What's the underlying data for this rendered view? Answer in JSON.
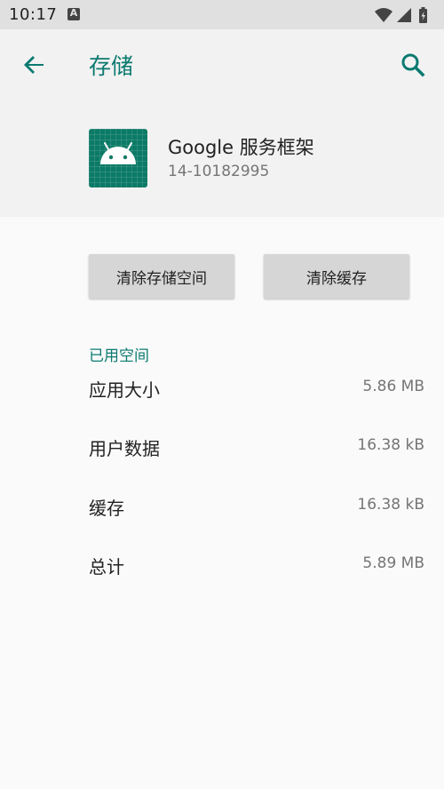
{
  "status_bar": {
    "time": "10:17",
    "notification_icon_letter": "A",
    "icons": [
      "wifi-icon",
      "cellular-icon",
      "battery-charging-icon"
    ]
  },
  "app_bar": {
    "title": "存储",
    "back_icon": "arrow-back-icon",
    "search_icon": "search-icon"
  },
  "app_info": {
    "name": "Google 服务框架",
    "version": "14-10182995",
    "icon": "android-robot-icon",
    "icon_color": "#0b7a66"
  },
  "actions": {
    "clear_storage": "清除存储空间",
    "clear_cache": "清除缓存"
  },
  "storage": {
    "section_title": "已用空间",
    "rows": [
      {
        "label": "应用大小",
        "value": "5.86 MB"
      },
      {
        "label": "用户数据",
        "value": "16.38 kB"
      },
      {
        "label": "缓存",
        "value": "16.38 kB"
      },
      {
        "label": "总计",
        "value": "5.89 MB"
      }
    ]
  },
  "colors": {
    "accent": "#0b7a70",
    "status_bar": "#e0e0e0",
    "header_bg": "#f2f2f2",
    "page_bg": "#fafafa",
    "button_bg": "#d6d6d6"
  }
}
